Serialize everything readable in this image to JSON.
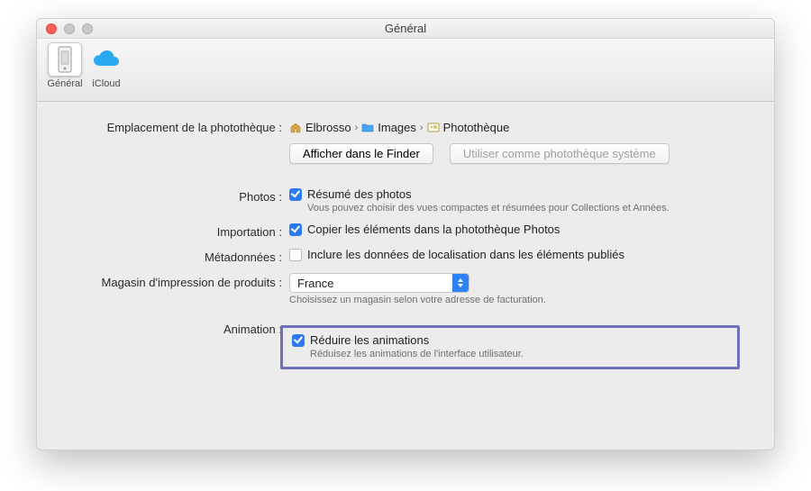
{
  "window": {
    "title": "Général"
  },
  "toolbar": {
    "tabs": [
      {
        "id": "general",
        "label": "Général",
        "selected": true
      },
      {
        "id": "icloud",
        "label": "iCloud",
        "selected": false
      }
    ]
  },
  "location": {
    "label": "Emplacement de la photothèque :",
    "path": [
      "Elbrosso",
      "Images",
      "Photothèque"
    ],
    "show_in_finder": "Afficher dans le Finder",
    "use_system_library": "Utiliser comme photothèque système",
    "use_system_library_enabled": false
  },
  "photos": {
    "label": "Photos :",
    "summary_checked": true,
    "summary_text": "Résumé des photos",
    "summary_hint": "Vous pouvez choisir des vues compactes et résumées pour Collections et Années."
  },
  "import": {
    "label": "Importation :",
    "copy_checked": true,
    "copy_text": "Copier les éléments dans la photothèque Photos"
  },
  "metadata": {
    "label": "Métadonnées :",
    "location_checked": false,
    "location_text": "Inclure les données de localisation dans les éléments publiés"
  },
  "store": {
    "label": "Magasin d'impression de produits :",
    "selected": "France",
    "hint": "Choisissez un magasin selon votre adresse de facturation."
  },
  "animation": {
    "label": "Animation :",
    "reduce_checked": true,
    "reduce_text": "Réduire les animations",
    "reduce_hint": "Réduisez les animations de l'interface utilisateur."
  }
}
